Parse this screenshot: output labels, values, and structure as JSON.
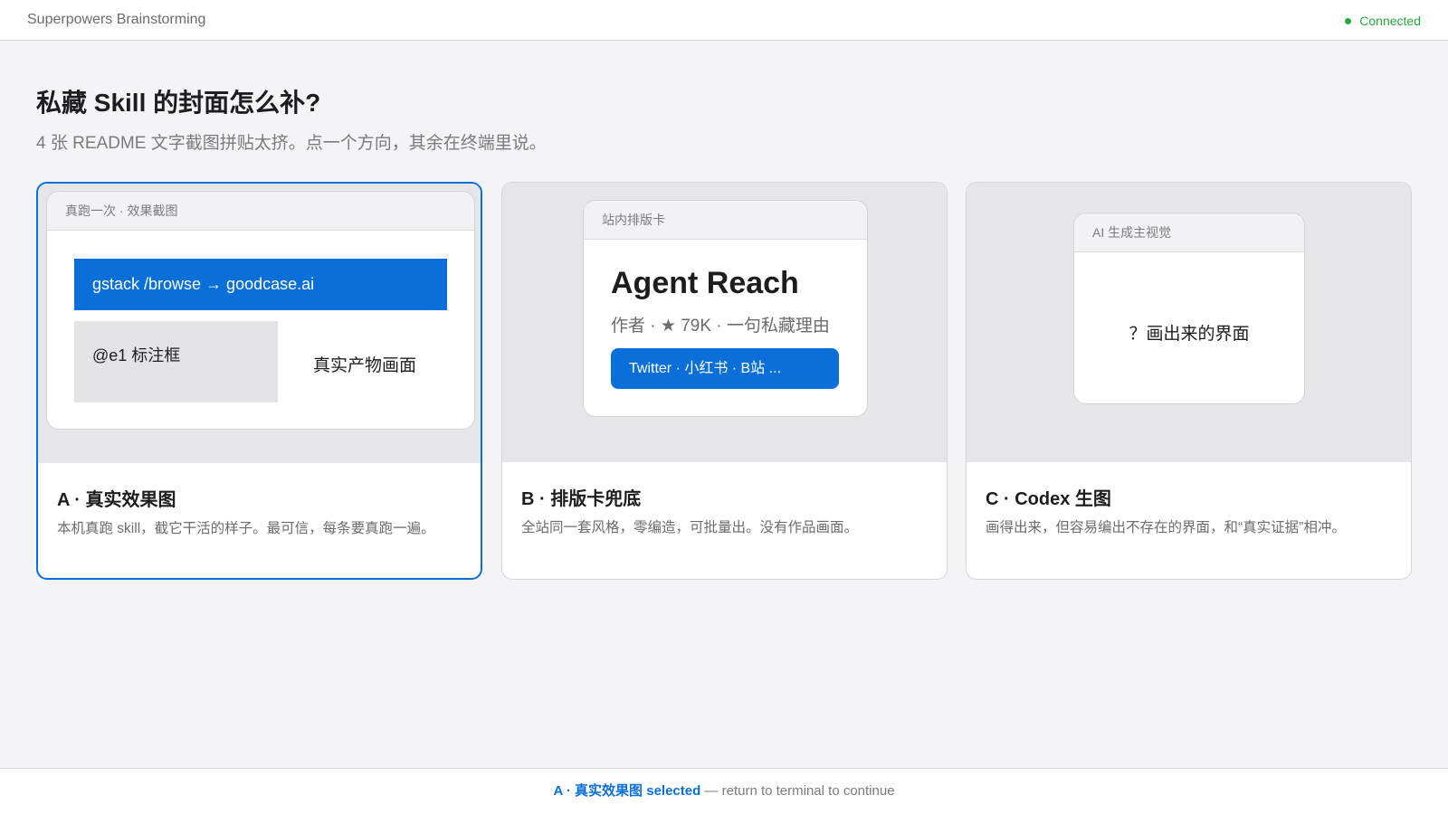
{
  "header": {
    "app_title": "Superpowers Brainstorming",
    "status": "Connected",
    "status_color": "#27a83f"
  },
  "main": {
    "title": "私藏 Skill 的封面怎么补?",
    "subtitle": "4 张 README 文字截图拼贴太挤。点一个方向，其余在终端里说。"
  },
  "options": [
    {
      "id": "A",
      "selected": true,
      "preview": {
        "header": "真跑一次 · 效果截图",
        "bar": "gstack /browse → goodcase.ai",
        "box": "@e1 标注框",
        "text": "真实产物画面"
      },
      "title": "A · 真实效果图",
      "desc": "本机真跑 skill，截它干活的样子。最可信，每条要真跑一遍。"
    },
    {
      "id": "B",
      "selected": false,
      "preview": {
        "header": "站内排版卡",
        "name": "Agent Reach",
        "meta": "作者 · ★ 79K · 一句私藏理由",
        "button": "Twitter · 小红书 · B站 ..."
      },
      "title": "B · 排版卡兜底",
      "desc": "全站同一套风格，零编造，可批量出。没有作品画面。"
    },
    {
      "id": "C",
      "selected": false,
      "preview": {
        "header": "AI 生成主视觉",
        "text": "？画出来的界面"
      },
      "title": "C · Codex 生图",
      "desc": "画得出来，但容易编出不存在的界面，和“真实证据”相冲。"
    }
  ],
  "footer": {
    "selected_label": "A · 真实效果图 selected",
    "rest": " — return to terminal to continue"
  },
  "colors": {
    "accent": "#0a6fd8",
    "background": "#f4f4f6"
  }
}
